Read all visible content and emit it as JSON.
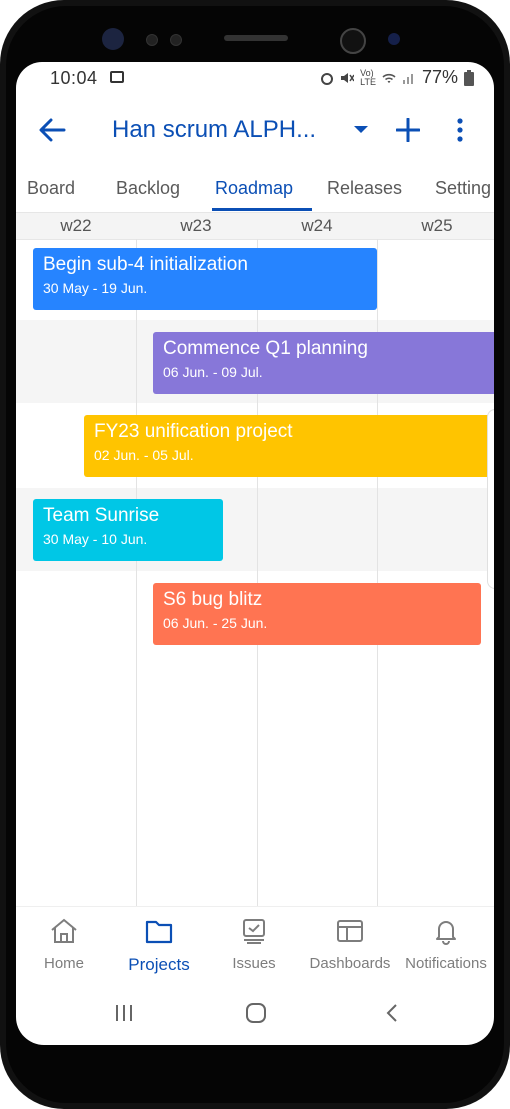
{
  "status_bar": {
    "time": "10:04",
    "battery": "77%"
  },
  "app_bar": {
    "title": "Han scrum ALPH..."
  },
  "tabs": [
    {
      "label": "Board"
    },
    {
      "label": "Backlog"
    },
    {
      "label": "Roadmap"
    },
    {
      "label": "Releases"
    },
    {
      "label": "Setting"
    }
  ],
  "active_tab": "Roadmap",
  "weeks": [
    "w22",
    "w23",
    "w24",
    "w25"
  ],
  "roadmap": [
    {
      "name": "Begin sub-4 initialization",
      "dates": "30 May - 19 Jun.",
      "color": "#2684ff"
    },
    {
      "name": "Commence Q1 planning",
      "dates": "06 Jun. - 09 Jul.",
      "color": "#8777d9"
    },
    {
      "name": "FY23 unification project",
      "dates": "02 Jun. - 05 Jul.",
      "color": "#ffc400"
    },
    {
      "name": "Team Sunrise",
      "dates": "30 May - 10 Jun.",
      "color": "#00c7e6"
    },
    {
      "name": "S6 bug blitz",
      "dates": "06 Jun. - 25 Jun.",
      "color": "#ff7452"
    }
  ],
  "bottom_nav": [
    {
      "label": "Home",
      "icon": "home-icon"
    },
    {
      "label": "Projects",
      "icon": "folder-icon"
    },
    {
      "label": "Issues",
      "icon": "issues-icon"
    },
    {
      "label": "Dashboards",
      "icon": "dashboard-icon"
    },
    {
      "label": "Notifications",
      "icon": "bell-icon"
    }
  ],
  "active_nav": "Projects",
  "colors": {
    "accent": "#0b4fb5"
  }
}
